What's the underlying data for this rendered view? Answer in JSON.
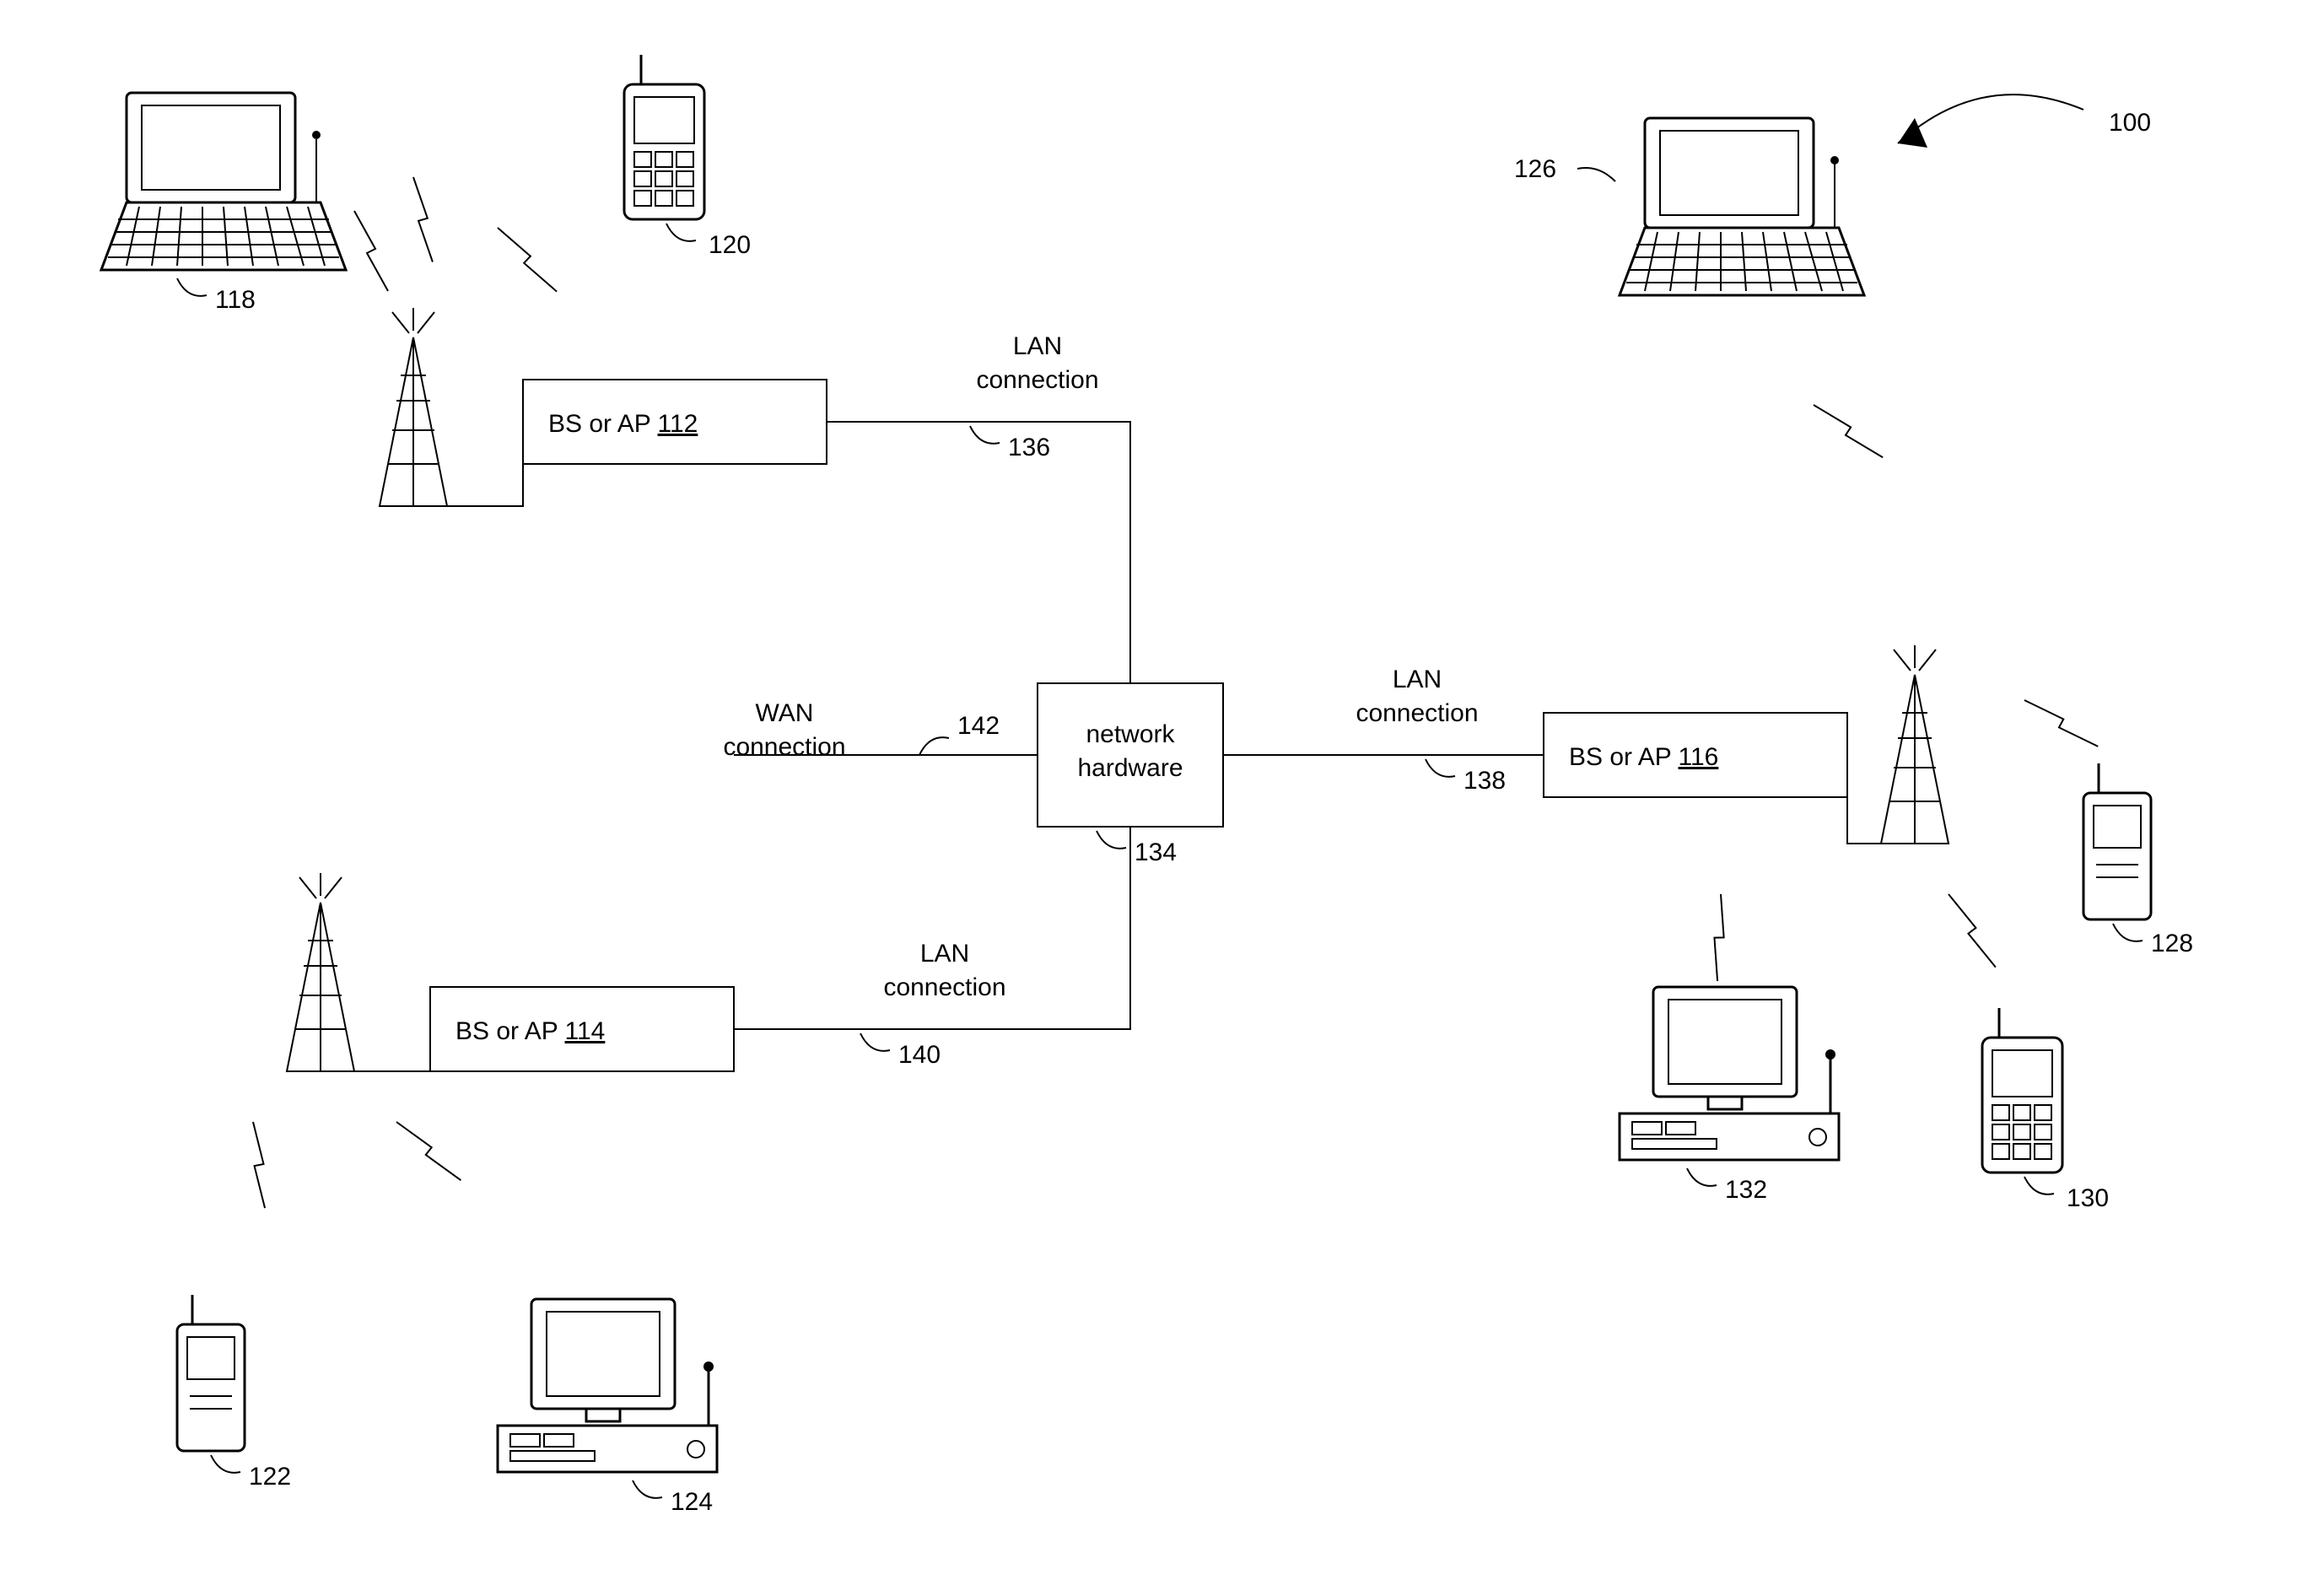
{
  "diagram": {
    "overall_ref": "100",
    "nodes": {
      "bs_ap_1": {
        "label_prefix": "BS or AP ",
        "ref": "112"
      },
      "bs_ap_2": {
        "label_prefix": "BS or AP ",
        "ref": "114"
      },
      "bs_ap_3": {
        "label_prefix": "BS or AP ",
        "ref": "116"
      },
      "hub": {
        "line1": "network",
        "line2": "hardware",
        "ref": "134"
      }
    },
    "links": {
      "lan_1": {
        "line1": "LAN",
        "line2": "connection",
        "ref": "136"
      },
      "lan_2": {
        "line1": "LAN",
        "line2": "connection",
        "ref": "140"
      },
      "lan_3": {
        "line1": "LAN",
        "line2": "connection",
        "ref": "138"
      },
      "wan": {
        "line1": "WAN",
        "line2": "connection",
        "ref": "142"
      }
    },
    "devices": {
      "laptop_1": {
        "ref": "118",
        "type": "laptop"
      },
      "phone_1": {
        "ref": "120",
        "type": "cellphone"
      },
      "handheld_1": {
        "ref": "122",
        "type": "handheld"
      },
      "pc_1": {
        "ref": "124",
        "type": "desktop"
      },
      "laptop_2": {
        "ref": "126",
        "type": "laptop"
      },
      "handheld_2": {
        "ref": "128",
        "type": "handheld"
      },
      "phone_2": {
        "ref": "130",
        "type": "cellphone"
      },
      "pc_2": {
        "ref": "132",
        "type": "desktop"
      }
    }
  }
}
